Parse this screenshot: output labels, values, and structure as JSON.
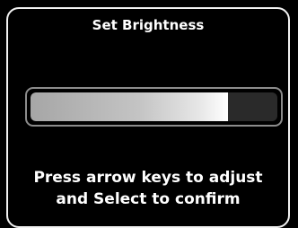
{
  "dialog": {
    "title": "Set Brightness",
    "instructions": {
      "line1": "Press arrow keys to adjust",
      "line2": "and Select to confirm"
    }
  },
  "brightness": {
    "level_percent": 80
  },
  "colors": {
    "background": "#000000",
    "border": "#f2f2f2",
    "slider_border": "#8c8c8c",
    "fill": "#c4c4c4",
    "text": "#ffffff"
  }
}
